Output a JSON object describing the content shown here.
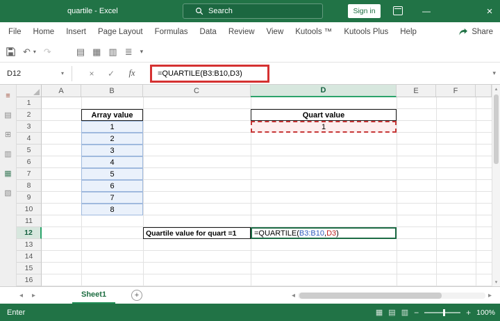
{
  "titlebar": {
    "title": "quartile - Excel",
    "search_placeholder": "Search",
    "sign_in_label": "Sign in"
  },
  "menubar": {
    "tabs": [
      "File",
      "Home",
      "Insert",
      "Page Layout",
      "Formulas",
      "Data",
      "Review",
      "View",
      "Kutools ™",
      "Kutools Plus",
      "Help"
    ],
    "share_label": "Share"
  },
  "formula_bar": {
    "name_box": "D12",
    "cancel": "×",
    "enter": "✓",
    "insert_function": "fx",
    "formula": "=QUARTILE(B3:B10,D3)"
  },
  "grid": {
    "columns": [
      "A",
      "B",
      "C",
      "D",
      "E",
      "F",
      ""
    ],
    "active_column": "D",
    "rows": [
      "1",
      "2",
      "3",
      "4",
      "5",
      "6",
      "7",
      "8",
      "9",
      "10",
      "11",
      "12",
      "13",
      "14",
      "15",
      "16"
    ],
    "active_row": "12",
    "cells": [
      {
        "ref": "B2",
        "text": "Array value",
        "style": "headerbox"
      },
      {
        "ref": "B3",
        "text": "1",
        "style": "array"
      },
      {
        "ref": "B4",
        "text": "2",
        "style": "array"
      },
      {
        "ref": "B5",
        "text": "3",
        "style": "array"
      },
      {
        "ref": "B6",
        "text": "4",
        "style": "array"
      },
      {
        "ref": "B7",
        "text": "5",
        "style": "array"
      },
      {
        "ref": "B8",
        "text": "6",
        "style": "array"
      },
      {
        "ref": "B9",
        "text": "7",
        "style": "array"
      },
      {
        "ref": "B10",
        "text": "8",
        "style": "array"
      },
      {
        "ref": "D2",
        "text": "Quart value",
        "style": "headerbox"
      },
      {
        "ref": "D3",
        "text": "1",
        "style": "refcell"
      },
      {
        "ref": "C12",
        "text": "Quartile value for quart =1",
        "style": "labelbox"
      }
    ],
    "formula_cell": {
      "ref": "D12",
      "style": "editcell",
      "parts": [
        {
          "text": "=QUARTILE(",
          "color": "#000000"
        },
        {
          "text": "B3:B10",
          "color": "#2e5bbd"
        },
        {
          "text": ",",
          "color": "#000000"
        },
        {
          "text": "D3",
          "color": "#bf2020"
        },
        {
          "text": ")",
          "color": "#000000"
        }
      ]
    }
  },
  "sheetbar": {
    "tabs": [
      {
        "label": "Sheet1",
        "active": true
      }
    ]
  },
  "statusbar": {
    "mode": "Enter",
    "zoom": "100%"
  },
  "colors": {
    "excel_green": "#217346",
    "annotation_red": "#d53131",
    "ref_fill_pink": "#fdeeee",
    "ref_border_red": "#c63636",
    "array_fill_blue": "#eaf1fb",
    "array_border_blue": "#9fb9de",
    "active_header_fill": "#d7e7de",
    "active_header_accent": "#2aa36a"
  },
  "icons": [
    "search-icon",
    "ribbon-display-options-icon",
    "minimize-icon",
    "close-icon",
    "share-icon",
    "save-icon",
    "undo-icon",
    "undo-dropdown-icon",
    "redo-icon",
    "table-icon",
    "grid-icon",
    "borders-icon",
    "list-icon",
    "qat-dropdown-icon",
    "namebox-dropdown-icon",
    "cancel-icon",
    "enter-icon",
    "insert-function-icon",
    "formulabar-expand-icon",
    "select-all-corner",
    "menu-icon",
    "clipboard-icon",
    "workbook-icon",
    "printer-icon",
    "sheet-grid-icon",
    "chart-icon",
    "scroll-up-icon",
    "scroll-down-icon",
    "prev-sheet-icon",
    "next-sheet-icon",
    "add-sheet-icon",
    "hscroll-left-icon",
    "hscroll-right-icon",
    "normal-view-icon",
    "page-layout-view-icon",
    "page-break-view-icon",
    "zoom-out-icon",
    "zoom-in-icon"
  ]
}
